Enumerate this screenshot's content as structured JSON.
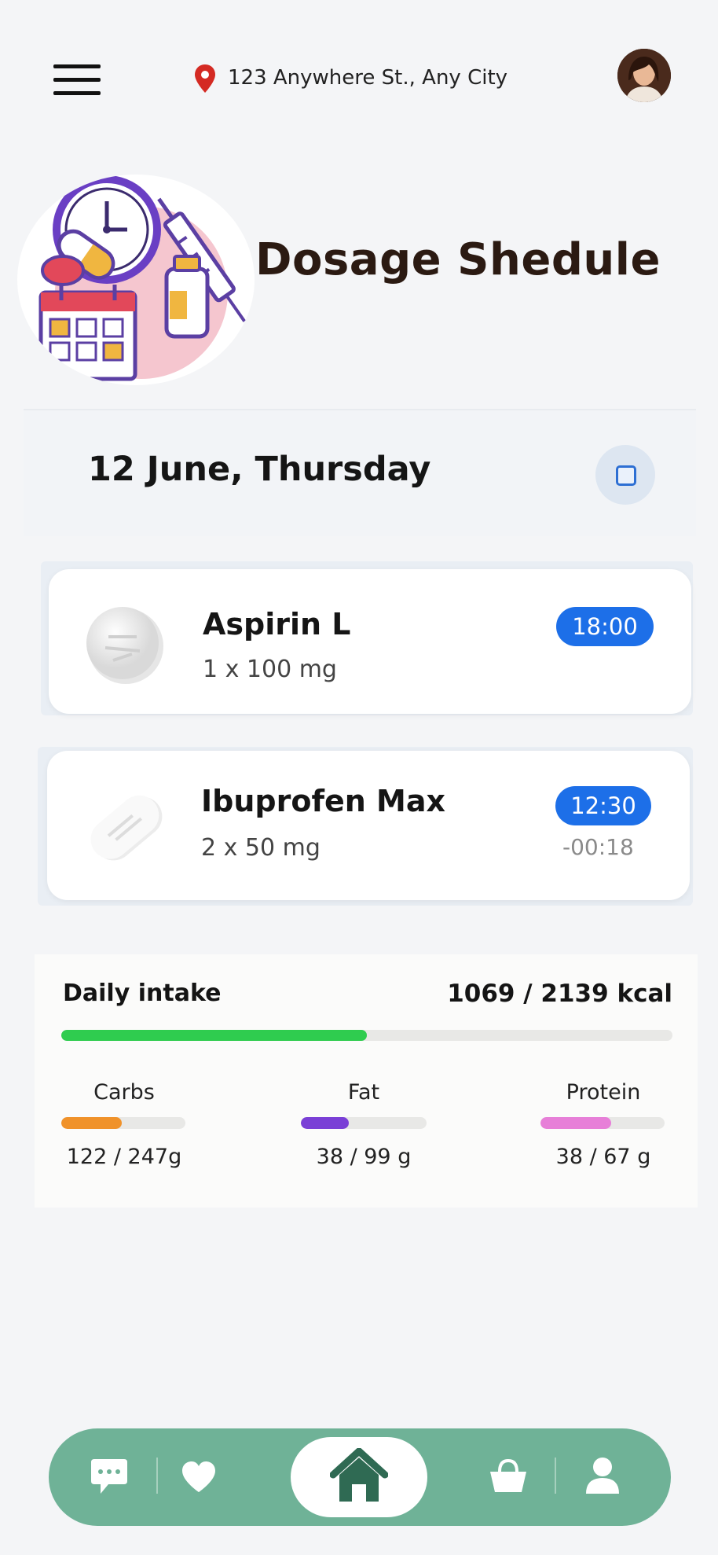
{
  "header": {
    "location": "123 Anywhere St., Any City"
  },
  "hero": {
    "title": "Dosage Shedule"
  },
  "schedule": {
    "date": "12 June, Thursday",
    "medications": [
      {
        "name": "Aspirin L",
        "dose": "1 x 100 mg",
        "time": "18:00",
        "sub": ""
      },
      {
        "name": "Ibuprofen Max",
        "dose": "2 x 50 mg",
        "time": "12:30",
        "sub": "-00:18"
      }
    ]
  },
  "intake": {
    "title": "Daily intake",
    "kcal": "1069 / 2139 kcal",
    "kcal_progress": 0.5,
    "macros": [
      {
        "label": "Carbs",
        "value": "122 / 247g",
        "progress": 0.49,
        "color": "#f0922a"
      },
      {
        "label": "Fat",
        "value": "38 / 99 g",
        "progress": 0.38,
        "color": "#7a3fd6"
      },
      {
        "label": "Protein",
        "value": "38 / 67 g",
        "progress": 0.57,
        "color": "#e77fd8"
      }
    ]
  },
  "colors": {
    "accent_blue": "#1d6fe8",
    "progress_green": "#2fcc4f",
    "nav_green": "#6fb297",
    "home_icon": "#2f6a53"
  },
  "nav": {
    "items": [
      "chat-icon",
      "heart-icon",
      "home-icon",
      "basket-icon",
      "user-icon"
    ]
  }
}
